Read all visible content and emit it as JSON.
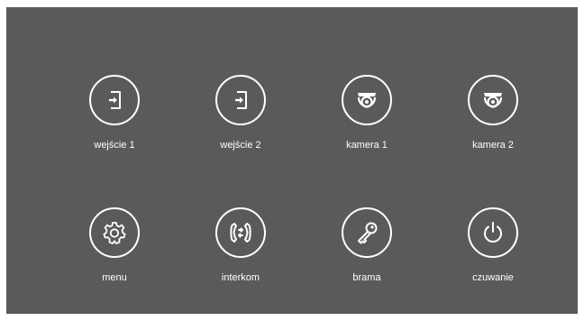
{
  "tiles": [
    {
      "label": "wejście 1",
      "icon": "door-entry-icon"
    },
    {
      "label": "wejście 2",
      "icon": "door-entry-icon"
    },
    {
      "label": "kamera 1",
      "icon": "dome-camera-icon"
    },
    {
      "label": "kamera 2",
      "icon": "dome-camera-icon"
    },
    {
      "label": "menu",
      "icon": "gear-icon"
    },
    {
      "label": "interkom",
      "icon": "intercom-icon"
    },
    {
      "label": "brama",
      "icon": "key-icon"
    },
    {
      "label": "czuwanie",
      "icon": "power-icon"
    }
  ],
  "colors": {
    "background": "#5a5a5a",
    "foreground": "#ffffff"
  }
}
